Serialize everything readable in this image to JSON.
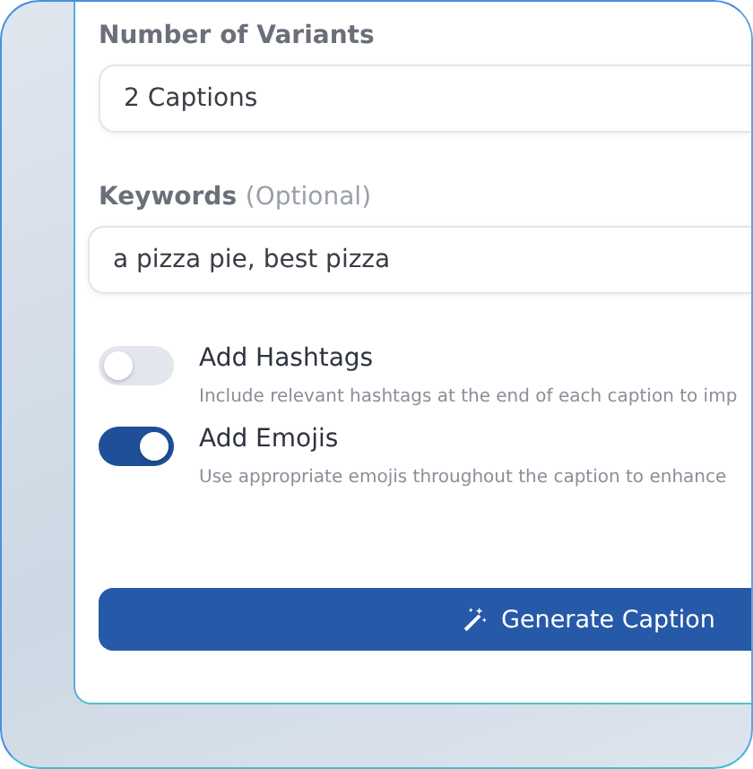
{
  "variants": {
    "label": "Number of Variants",
    "value": "2 Captions"
  },
  "keywords": {
    "label": "Keywords",
    "hint": "(Optional)",
    "value": "a pizza pie, best pizza"
  },
  "options": [
    {
      "title": "Add Hashtags",
      "description": "Include relevant hashtags at the end of each caption to imp",
      "on": false
    },
    {
      "title": "Add Emojis",
      "description": "Use appropriate emojis throughout the caption to enhance",
      "on": true
    }
  ],
  "button": {
    "label": "Generate Caption"
  }
}
